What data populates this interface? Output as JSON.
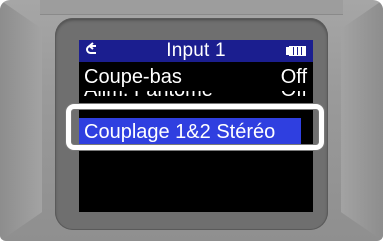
{
  "header": {
    "title": "Input 1",
    "back_icon": "back-arrow-icon",
    "battery_icon": "battery-full-icon"
  },
  "menu": {
    "items": [
      {
        "label": "Coupe-bas",
        "value": "Off"
      },
      {
        "label": "Alim. Fantôme",
        "value": "Off"
      },
      {
        "label": "Couplage 1&2 Stéréo",
        "value": ""
      }
    ]
  },
  "colors": {
    "header_bg": "#1b1e8f",
    "selection_bg": "#2f3fe0",
    "screen_bg": "#000000",
    "text": "#ffffff",
    "callout": "#ffffff"
  }
}
